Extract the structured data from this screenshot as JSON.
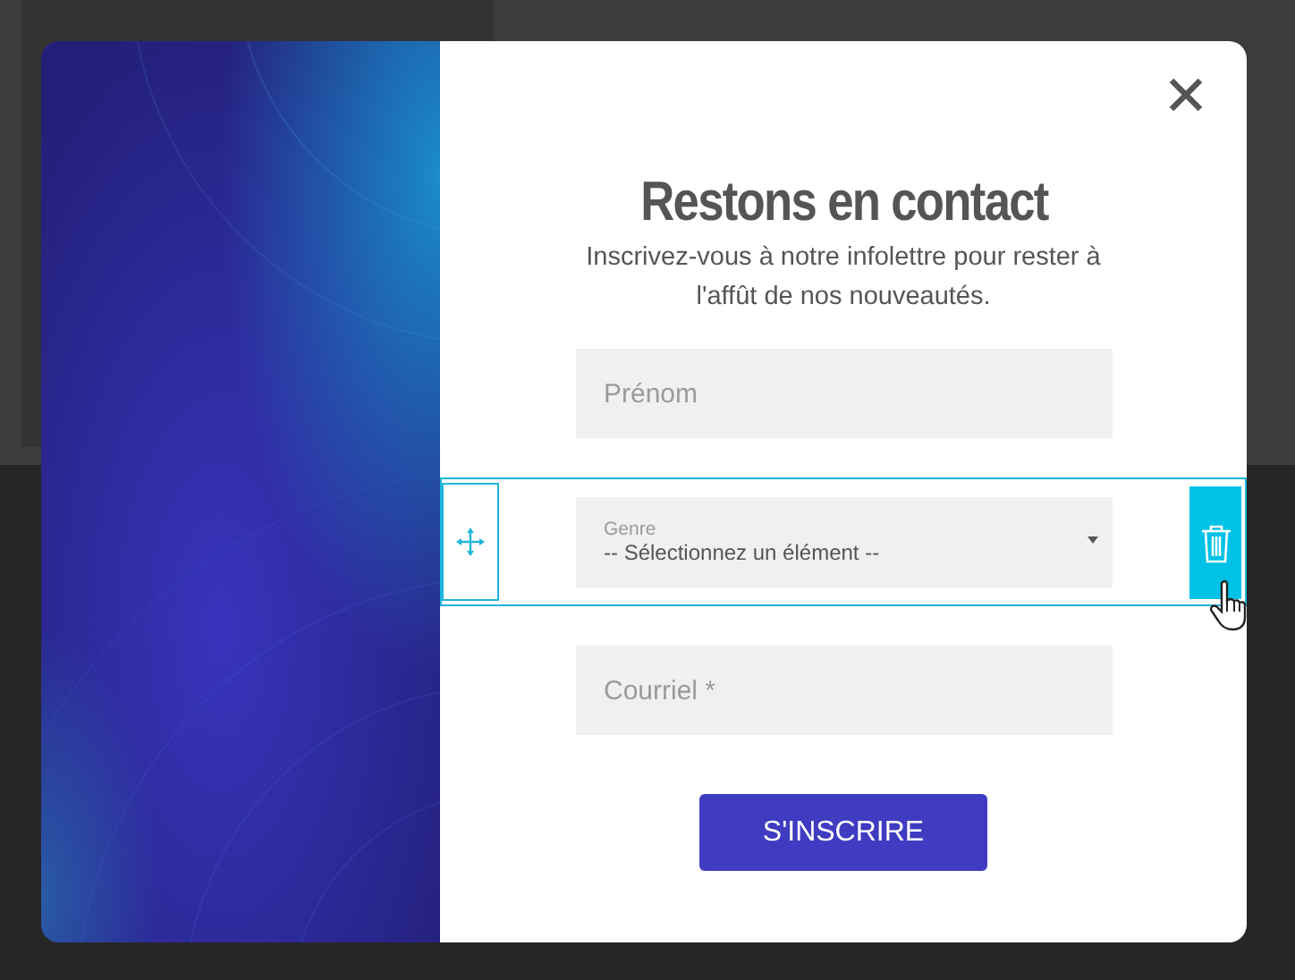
{
  "modal": {
    "title": "Restons en contact",
    "subtitle": "Inscrivez-vous à notre infolettre pour rester à l'affût de nos nouveautés.",
    "fields": [
      {
        "kind": "text",
        "placeholder": "Prénom",
        "selected": false
      },
      {
        "kind": "select",
        "label": "Genre",
        "value": "-- Sélectionnez un élément --",
        "selected": true
      },
      {
        "kind": "text",
        "placeholder": "Courriel *",
        "selected": false
      }
    ],
    "button": "S'INSCRIRE"
  }
}
